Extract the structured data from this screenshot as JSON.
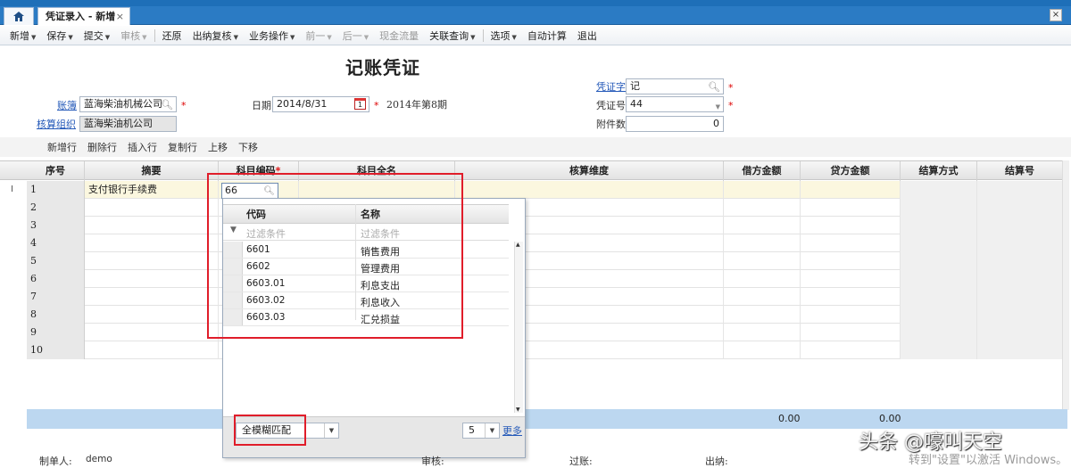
{
  "tabs": {
    "home_icon": "home-icon",
    "active_tab": "凭证录入 - 新增",
    "close": "×"
  },
  "toolbar": {
    "new": "新增",
    "save": "保存",
    "submit": "提交",
    "audit": "审核",
    "restore": "还原",
    "cashier_review": "出纳复核",
    "business_ops": "业务操作",
    "prev": "前一",
    "next": "后一",
    "cash_flow": "现金流量",
    "related_query": "关联查询",
    "options": "选项",
    "auto_calc": "自动计算",
    "exit": "退出"
  },
  "header": {
    "title": "记账凭证",
    "book_label": "账簿",
    "book_value": "蓝海柴油机械公司",
    "org_label": "核算组织",
    "org_value": "蓝海柴油机公司",
    "date_label": "日期",
    "date_value": "2014/8/31",
    "period_text": "2014年第8期",
    "voucher_word_label": "凭证字",
    "voucher_word_value": "记",
    "voucher_no_label": "凭证号",
    "voucher_no_value": "44",
    "attachments_label": "附件数",
    "attachments_value": "0"
  },
  "grid_toolbar": {
    "add_row": "新增行",
    "delete_row": "删除行",
    "insert_row": "插入行",
    "copy_row": "复制行",
    "move_up": "上移",
    "move_down": "下移"
  },
  "grid": {
    "columns": {
      "seq": "序号",
      "summary": "摘要",
      "account_code": "科目编码",
      "account_name": "科目全名",
      "dimension": "核算维度",
      "debit": "借方金额",
      "credit": "贷方金额",
      "settle_method": "结算方式",
      "settle_no": "结算号"
    },
    "rows": [
      {
        "seq": "1",
        "summary": "支付银行手续费"
      },
      {
        "seq": "2",
        "summary": ""
      },
      {
        "seq": "3",
        "summary": ""
      },
      {
        "seq": "4",
        "summary": ""
      },
      {
        "seq": "5",
        "summary": ""
      },
      {
        "seq": "6",
        "summary": ""
      },
      {
        "seq": "7",
        "summary": ""
      },
      {
        "seq": "8",
        "summary": ""
      },
      {
        "seq": "9",
        "summary": ""
      },
      {
        "seq": "10",
        "summary": ""
      }
    ],
    "row_marker": "I",
    "code_input_value": "66",
    "debit_total": "0.00",
    "credit_total": "0.00"
  },
  "dropdown": {
    "col_code": "代码",
    "col_name": "名称",
    "filter_placeholder_code": "过滤条件",
    "filter_placeholder_name": "过滤条件",
    "items": [
      {
        "code": "6601",
        "name": "销售费用"
      },
      {
        "code": "6602",
        "name": "管理费用"
      },
      {
        "code": "6603.01",
        "name": "利息支出"
      },
      {
        "code": "6603.02",
        "name": "利息收入"
      },
      {
        "code": "6603.03",
        "name": "汇兑损益"
      }
    ],
    "match_mode": "全模糊匹配",
    "page_size": "5",
    "more": "更多"
  },
  "footer": {
    "maker_label": "制单人:",
    "maker_value": "demo",
    "auditor_label": "审核:",
    "poster_label": "过账:",
    "cashier_label": "出纳:"
  },
  "overlay": {
    "watermark": "头条 @嚎叫天空",
    "activation": "转到\"设置\"以激活 Windows。"
  },
  "colors": {
    "accent": "#2b7bc4",
    "highlight_box": "#e01d2a",
    "total_bar": "#bcd7f0",
    "selected_row": "#fbf7df",
    "link": "#2358b8"
  }
}
